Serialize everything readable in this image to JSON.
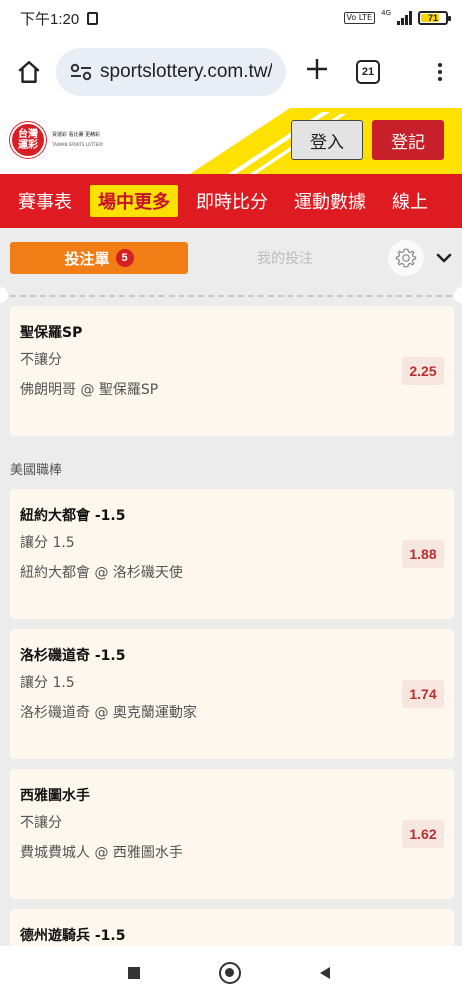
{
  "status_bar": {
    "time": "下午1:20",
    "network": "4G",
    "volte": "Vo LTE",
    "battery_level": "71",
    "icons": [
      "photo-icon",
      "volte-icon",
      "signal-icon",
      "battery-icon"
    ]
  },
  "browser": {
    "url": "sportslottery.com.tw/",
    "tab_count": "21",
    "icons": [
      "home-icon",
      "tune-icon",
      "plus-icon",
      "tabs-icon",
      "more-vert-icon"
    ]
  },
  "site_header": {
    "logo_line1": "台灣",
    "logo_line2": "運彩",
    "logo_text": "買運彩 看比賽 更精彩",
    "logo_subtext": "TAIWAN SPORTS LOTTERY",
    "login_label": "登入",
    "register_label": "登記",
    "colors": {
      "red": "#de1b21",
      "yellow": "#ffe100"
    }
  },
  "nav": {
    "items": [
      {
        "label": "賽事表",
        "active": false
      },
      {
        "label": "場中更多",
        "active": true
      },
      {
        "label": "即時比分",
        "active": false
      },
      {
        "label": "運動數據",
        "active": false
      },
      {
        "label": "線上",
        "active": false
      }
    ]
  },
  "slip": {
    "tab_slip_label": "投注單",
    "slip_count": "5",
    "tab_mine_label": "我的投注",
    "accent_color": "#f07d16",
    "group_label": "美國職棒",
    "bets": [
      {
        "selection": "聖保羅SP",
        "market": "不讓分",
        "event": "佛朗明哥 @ 聖保羅SP",
        "odds": "2.25"
      },
      {
        "selection": "紐約大都會 -1.5",
        "market": "讓分 1.5",
        "event": "紐約大都會 @ 洛杉磯天使",
        "odds": "1.88"
      },
      {
        "selection": "洛杉磯道奇 -1.5",
        "market": "讓分 1.5",
        "event": "洛杉磯道奇 @ 奧克蘭運動家",
        "odds": "1.74"
      },
      {
        "selection": "西雅圖水手",
        "market": "不讓分",
        "event": "費城費城人 @ 西雅圖水手",
        "odds": "1.62"
      },
      {
        "selection": "德州遊騎兵 -1.5",
        "market": "",
        "event": "",
        "odds": ""
      }
    ]
  }
}
